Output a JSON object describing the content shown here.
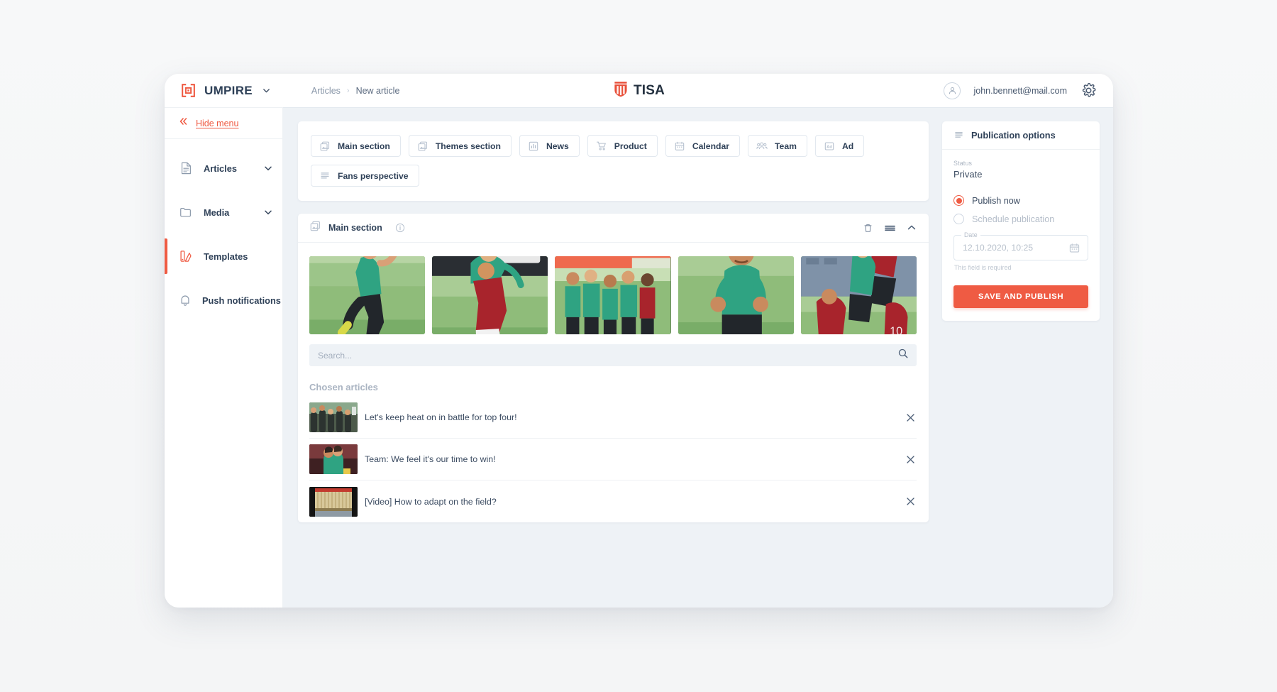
{
  "topbar": {
    "brand_name": "UMPIRE",
    "brand_caret_icon": "chevron-down-icon",
    "logo_word": "TISA",
    "breadcrumb": {
      "root": "Articles",
      "separator": "›",
      "current": "New article"
    },
    "user_email": "john.bennett@mail.com",
    "avatar_icon": "user-icon",
    "settings_icon": "gear-icon"
  },
  "sidebar": {
    "hide_menu_label": "Hide menu",
    "collapse_icon": "double-chevron-left-icon",
    "items": [
      {
        "label": "Articles",
        "icon": "document-icon",
        "has_chevron": true,
        "active": false
      },
      {
        "label": "Media",
        "icon": "folder-icon",
        "has_chevron": true,
        "active": false
      },
      {
        "label": "Templates",
        "icon": "template-icon",
        "has_chevron": false,
        "active": true
      },
      {
        "label": "Push notifications",
        "icon": "bell-icon",
        "has_chevron": false,
        "active": false
      }
    ]
  },
  "sections": {
    "chips": [
      {
        "label": "Main section",
        "icon": "image-stack-icon"
      },
      {
        "label": "Themes section",
        "icon": "image-stack-icon"
      },
      {
        "label": "News",
        "icon": "bar-chart-icon"
      },
      {
        "label": "Product",
        "icon": "cart-icon"
      },
      {
        "label": "Calendar",
        "icon": "calendar-icon"
      },
      {
        "label": "Team",
        "icon": "people-icon"
      },
      {
        "label": "Ad",
        "icon": "ad-icon"
      },
      {
        "label": "Fans perspective",
        "icon": "list-lines-icon"
      }
    ]
  },
  "main_panel": {
    "title": "Main section",
    "title_icon": "image-stack-icon",
    "info_icon": "info-icon",
    "delete_icon": "trash-icon",
    "drag_icon": "drag-handle-icon",
    "collapse_icon": "chevron-up-icon",
    "thumbnails": [
      {
        "name": "player-kicking-ball"
      },
      {
        "name": "players-heading-duel"
      },
      {
        "name": "team-celebration-run"
      },
      {
        "name": "player-celebrating-fists"
      },
      {
        "name": "aerial-duel-header"
      }
    ],
    "search": {
      "placeholder": "Search...",
      "value": "",
      "icon": "search-icon"
    },
    "chosen_articles_label": "Chosen articles",
    "articles": [
      {
        "title": "Let's keep heat on in battle for top four!",
        "thumb": "crowd-celebration",
        "remove_icon": "close-icon"
      },
      {
        "title": "Team: We feel it's our time to win!",
        "thumb": "two-players-hug",
        "remove_icon": "close-icon"
      },
      {
        "title": "[Video] How to adapt on the field?",
        "thumb": "video-stadium-seats",
        "remove_icon": "close-icon"
      }
    ]
  },
  "publication": {
    "title": "Publication options",
    "title_icon": "list-lines-icon",
    "status_label": "Status",
    "status_value": "Private",
    "options": [
      {
        "label": "Publish now",
        "selected": true,
        "disabled": false
      },
      {
        "label": "Schedule publication",
        "selected": false,
        "disabled": true
      }
    ],
    "date_legend": "Date",
    "date_value": "12.10.2020, 10:25",
    "date_icon": "calendar-icon",
    "helper_text": "This field is required",
    "save_button_label": "SAVE AND PUBLISH"
  },
  "colors": {
    "accent": "#EF5B43",
    "ink": "#2F4158",
    "muted": "#A3AEBD",
    "content_bg": "#EEF2F6"
  }
}
